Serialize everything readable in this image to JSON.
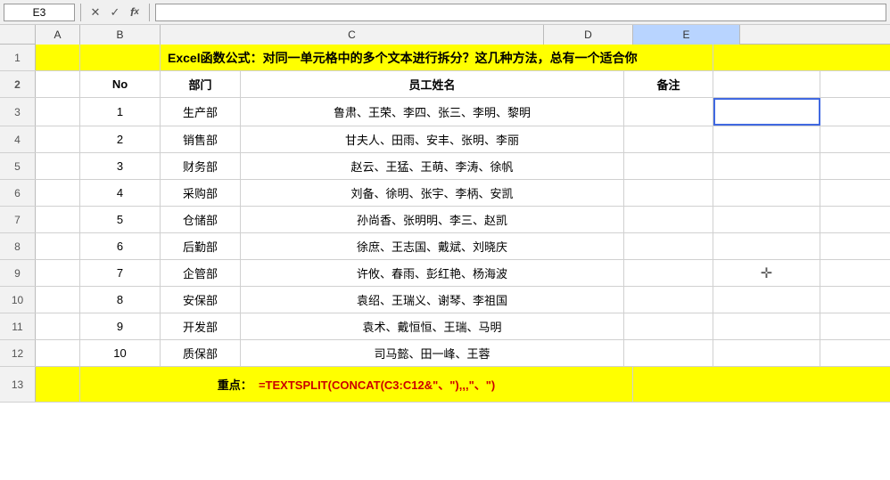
{
  "namebox": "E3",
  "formula_bar": "",
  "col_headers": [
    "",
    "A",
    "B",
    "C",
    "D",
    "E"
  ],
  "title_row": {
    "text": "Excel函数公式：对同一单元格中的多个文本进行拆分？这几种方法，总有一个适合你"
  },
  "header_row": {
    "no": "No",
    "dept": "部门",
    "employees": "员工姓名",
    "note": "备注"
  },
  "data_rows": [
    {
      "row": "1",
      "no": "1",
      "dept": "生产部",
      "employees": "鲁肃、王荣、李四、张三、李明、黎明",
      "note": ""
    },
    {
      "row": "2",
      "no": "2",
      "dept": "销售部",
      "employees": "甘夫人、田雨、安丰、张明、李丽",
      "note": ""
    },
    {
      "row": "3",
      "no": "3",
      "dept": "财务部",
      "employees": "赵云、王猛、王萌、李涛、徐帆",
      "note": ""
    },
    {
      "row": "4",
      "no": "4",
      "dept": "采购部",
      "employees": "刘备、徐明、张宇、李柄、安凯",
      "note": ""
    },
    {
      "row": "5",
      "no": "5",
      "dept": "仓储部",
      "employees": "孙尚香、张明明、李三、赵凯",
      "note": ""
    },
    {
      "row": "6",
      "no": "6",
      "dept": "后勤部",
      "employees": "徐庶、王志国、戴斌、刘晓庆",
      "note": ""
    },
    {
      "row": "7",
      "no": "7",
      "dept": "企管部",
      "employees": "许攸、春雨、彭红艳、杨海波",
      "note": ""
    },
    {
      "row": "8",
      "no": "8",
      "dept": "安保部",
      "employees": "袁绍、王瑞义、谢琴、李祖国",
      "note": ""
    },
    {
      "row": "9",
      "no": "9",
      "dept": "开发部",
      "employees": "袁术、戴恒恒、王瑞、马明",
      "note": ""
    },
    {
      "row": "10",
      "no": "10",
      "dept": "质保部",
      "employees": "司马懿、田一峰、王蓉",
      "note": ""
    }
  ],
  "formula_row": {
    "label": "重点：",
    "formula": "=TEXTSPLIT(CONCAT(C3:C12&\"、\"),,\"、\")"
  },
  "row_numbers": [
    "1",
    "2",
    "3",
    "4",
    "5",
    "6",
    "7",
    "8",
    "9",
    "10",
    "11",
    "12",
    "13"
  ]
}
